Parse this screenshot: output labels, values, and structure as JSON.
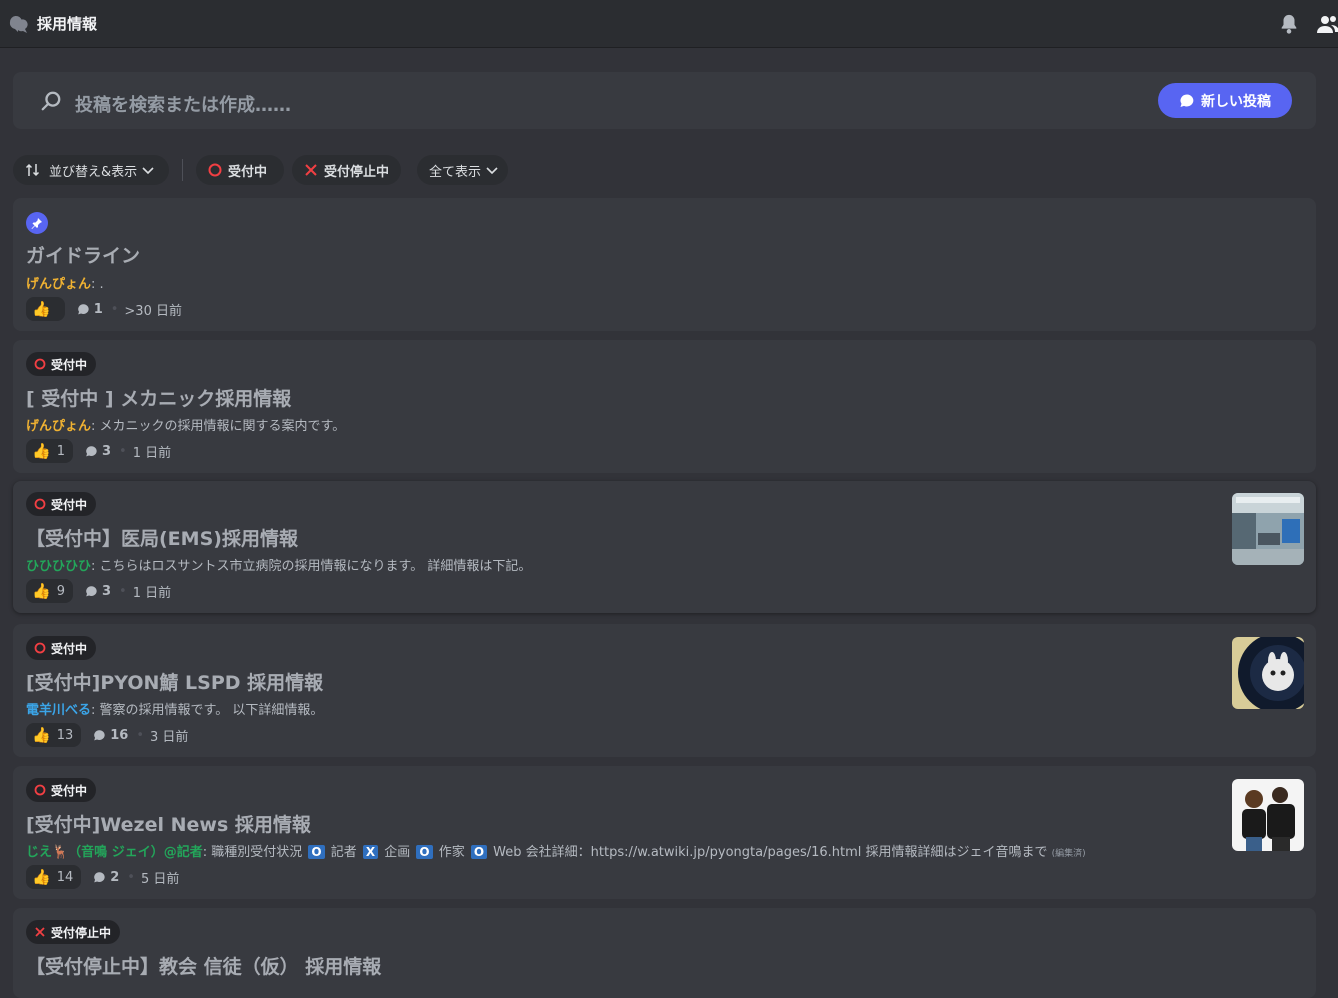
{
  "topbar": {
    "title": "採用情報",
    "channel_icon": "forum-icon",
    "bell_icon": "bell-icon",
    "members_icon": "members-icon"
  },
  "search": {
    "placeholder": "投稿を検索または作成……",
    "new_post_label": "新しい投稿"
  },
  "filters": {
    "sort_label": "並び替え&表示",
    "tag_open": "受付中",
    "tag_closed": "受付停止中",
    "show_all": "全て表示"
  },
  "posts": [
    {
      "pinned": true,
      "title": "ガイドライン",
      "author": "げんぴょん",
      "author_color": "#f0b232",
      "preview": " .",
      "reactions": "",
      "comments": "1",
      "time": ">30 日前"
    },
    {
      "tag": "受付中",
      "title": "[ 受付中 ] メカニック採用情報",
      "author": "げんぴょん",
      "author_color": "#f0b232",
      "preview": " メカニックの採用情報に関する案内です。",
      "reactions": "1",
      "comments": "3",
      "time": "1 日前"
    },
    {
      "tag": "受付中",
      "title": "【受付中】医局(EMS)採用情報",
      "author": "ひひひひひ",
      "author_color": "#23a55a",
      "preview": " こちらはロスサントス市立病院の採用情報になります。 詳細情報は下記。",
      "reactions": "9",
      "comments": "3",
      "time": "1 日前"
    },
    {
      "tag": "受付中",
      "title": "[受付中]PYON鯖 LSPD 採用情報",
      "author": "電羊川べる",
      "author_color": "#3ba5e8",
      "preview": " 警察の採用情報です。 以下詳細情報。",
      "reactions": "13",
      "comments": "16",
      "time": "3 日前"
    },
    {
      "tag": "受付中",
      "title": "[受付中]Wezel News 採用情報",
      "author": "じえ🦌（音鳴 ジェイ）@記者",
      "author_color": "#23a55a",
      "preview_parts": [
        " 職種別受付状況 ",
        "O",
        " 記者 ",
        "X",
        " 企画 ",
        "O",
        " 作家 ",
        "O",
        " Web 会社詳細：https://w.atwiki.jp/pyongta/pages/16.html 採用情報詳細はジェイ音鳴まで "
      ],
      "edited": "(編集済)",
      "reactions": "14",
      "comments": "2",
      "time": "5 日前"
    },
    {
      "tag": "受付停止中",
      "title": "【受付停止中】教会 信徒（仮） 採用情報"
    }
  ]
}
